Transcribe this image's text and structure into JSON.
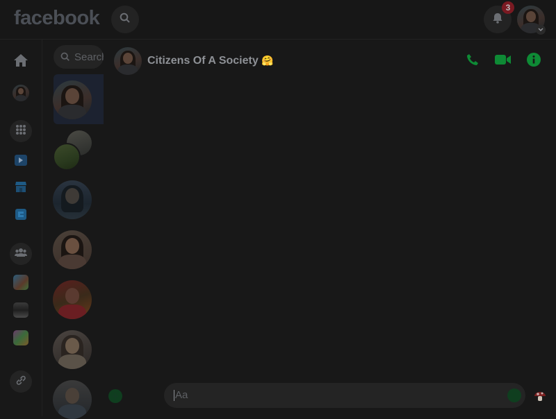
{
  "header": {
    "logo": "facebook",
    "notification_count": "3"
  },
  "icons": {
    "search": "search-icon",
    "home": "home-icon",
    "apps": "grid-icon",
    "watch": "play-icon",
    "marketplace": "shop-icon",
    "gaming": "gaming-icon",
    "groups": "groups-icon",
    "link": "link-icon",
    "call": "phone-icon",
    "video": "video-camera-icon",
    "info": "info-icon"
  },
  "chatlist": {
    "search_placeholder": "Search Messenger"
  },
  "conversation": {
    "title": "Citizens Of A Society",
    "title_emoji": "🤗",
    "composer_placeholder": "Aa"
  },
  "colors": {
    "accent_green": "#0e8a35",
    "badge_red": "#7a1a22",
    "background": "#181818"
  }
}
